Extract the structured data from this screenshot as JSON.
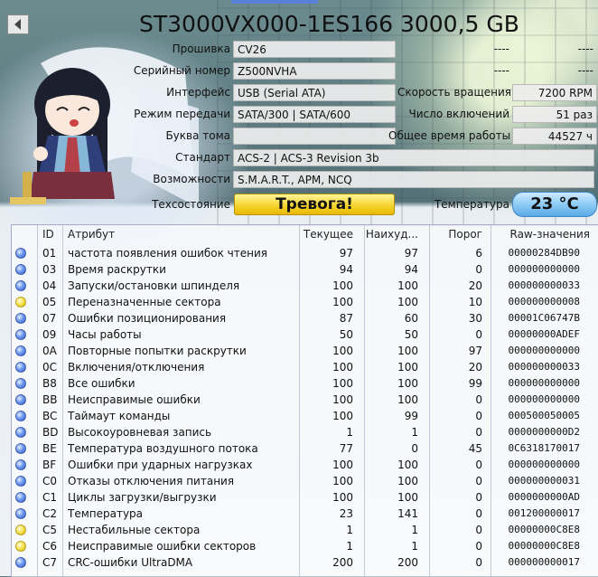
{
  "window": {
    "title": "ST3000VX000-1ES166 3000,5 GB"
  },
  "fields_left": [
    {
      "label": "Прошивка",
      "value": "CV26"
    },
    {
      "label": "Серийный номер",
      "value": "Z500NVHA"
    },
    {
      "label": "Интерфейс",
      "value": "USB (Serial ATA)"
    },
    {
      "label": "Режим передачи",
      "value": "SATA/300 | SATA/600"
    },
    {
      "label": "Буква тома",
      "value": ""
    },
    {
      "label": "Стандарт",
      "value": "ACS-2 | ACS-3 Revision 3b"
    },
    {
      "label": "Возможности",
      "value": "S.M.A.R.T., APM, NCQ"
    }
  ],
  "fields_right": [
    {
      "label": "----",
      "value": "----"
    },
    {
      "label": "----",
      "value": "----"
    },
    {
      "label": "Скорость вращения",
      "value": "7200 RPM"
    },
    {
      "label": "Число включений",
      "value": "51 раз"
    },
    {
      "label": "Общее время работы",
      "value": "44527 ч"
    }
  ],
  "health": {
    "label": "Техсостояние",
    "value": "Тревога!",
    "color": "#f7d532"
  },
  "temperature": {
    "label": "Температура",
    "value": "23 °C",
    "color": "#8ecbf5"
  },
  "table": {
    "headers": [
      "ID",
      "Атрибут",
      "Текущее",
      "Наихуд...",
      "Порог",
      "Raw-значения"
    ],
    "rows": [
      {
        "status": "blue",
        "id": "01",
        "name": "частота появления ошибок чтения",
        "current": "97",
        "worst": "97",
        "threshold": "6",
        "raw": "00000284DB90"
      },
      {
        "status": "blue",
        "id": "03",
        "name": "Время раскрутки",
        "current": "94",
        "worst": "94",
        "threshold": "0",
        "raw": "000000000000"
      },
      {
        "status": "blue",
        "id": "04",
        "name": "Запуски/остановки шпинделя",
        "current": "100",
        "worst": "100",
        "threshold": "20",
        "raw": "000000000033"
      },
      {
        "status": "yellow",
        "id": "05",
        "name": "Переназначенные сектора",
        "current": "100",
        "worst": "100",
        "threshold": "10",
        "raw": "000000000008"
      },
      {
        "status": "blue",
        "id": "07",
        "name": "Ошибки позиционирования",
        "current": "87",
        "worst": "60",
        "threshold": "30",
        "raw": "00001C06747B"
      },
      {
        "status": "blue",
        "id": "09",
        "name": "Часы работы",
        "current": "50",
        "worst": "50",
        "threshold": "0",
        "raw": "00000000ADEF"
      },
      {
        "status": "blue",
        "id": "0A",
        "name": "Повторные попытки раскрутки",
        "current": "100",
        "worst": "100",
        "threshold": "97",
        "raw": "000000000000"
      },
      {
        "status": "blue",
        "id": "0C",
        "name": "Включения/отключения",
        "current": "100",
        "worst": "100",
        "threshold": "20",
        "raw": "000000000033"
      },
      {
        "status": "blue",
        "id": "B8",
        "name": "Все ошибки",
        "current": "100",
        "worst": "100",
        "threshold": "99",
        "raw": "000000000000"
      },
      {
        "status": "blue",
        "id": "BB",
        "name": "Неисправимые ошибки",
        "current": "100",
        "worst": "100",
        "threshold": "0",
        "raw": "000000000000"
      },
      {
        "status": "blue",
        "id": "BC",
        "name": "Таймаут команды",
        "current": "100",
        "worst": "99",
        "threshold": "0",
        "raw": "000500050005"
      },
      {
        "status": "blue",
        "id": "BD",
        "name": "Высокоуровневая запись",
        "current": "1",
        "worst": "1",
        "threshold": "0",
        "raw": "0000000000D2"
      },
      {
        "status": "blue",
        "id": "BE",
        "name": "Температура воздушного потока",
        "current": "77",
        "worst": "0",
        "threshold": "45",
        "raw": "0C6318170017"
      },
      {
        "status": "blue",
        "id": "BF",
        "name": "Ошибки при ударных нагрузках",
        "current": "100",
        "worst": "100",
        "threshold": "0",
        "raw": "000000000000"
      },
      {
        "status": "blue",
        "id": "C0",
        "name": "Отказы отключения питания",
        "current": "100",
        "worst": "100",
        "threshold": "0",
        "raw": "000000000031"
      },
      {
        "status": "blue",
        "id": "C1",
        "name": "Циклы загрузки/выгрузки",
        "current": "100",
        "worst": "100",
        "threshold": "0",
        "raw": "0000000000AD"
      },
      {
        "status": "blue",
        "id": "C2",
        "name": "Температура",
        "current": "23",
        "worst": "141",
        "threshold": "0",
        "raw": "001200000017"
      },
      {
        "status": "yellow",
        "id": "C5",
        "name": "Нестабильные сектора",
        "current": "1",
        "worst": "1",
        "threshold": "0",
        "raw": "00000000C8E8"
      },
      {
        "status": "yellow",
        "id": "C6",
        "name": "Неисправимые ошибки секторов",
        "current": "1",
        "worst": "1",
        "threshold": "0",
        "raw": "00000000C8E8"
      },
      {
        "status": "blue",
        "id": "C7",
        "name": "CRC-ошибки UltraDMA",
        "current": "200",
        "worst": "200",
        "threshold": "0",
        "raw": "000000000017"
      }
    ]
  }
}
